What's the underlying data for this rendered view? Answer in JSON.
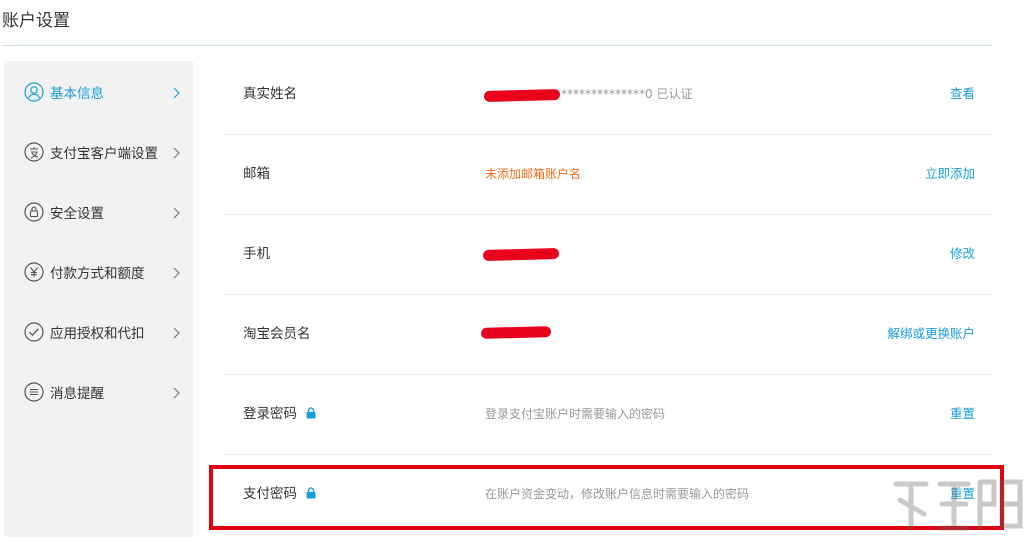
{
  "page": {
    "title": "账户设置"
  },
  "sidebar": {
    "items": [
      {
        "label": "基本信息",
        "icon": "user-icon",
        "active": true
      },
      {
        "label": "支付宝客户端设置",
        "icon": "alipay-client-icon",
        "active": false
      },
      {
        "label": "安全设置",
        "icon": "lock-icon",
        "active": false
      },
      {
        "label": "付款方式和额度",
        "icon": "yen-icon",
        "active": false
      },
      {
        "label": "应用授权和代扣",
        "icon": "check-circle-icon",
        "active": false
      },
      {
        "label": "消息提醒",
        "icon": "message-icon",
        "active": false
      }
    ]
  },
  "rows": [
    {
      "label": "真实姓名",
      "value": "**************0 已认证",
      "action": "查看",
      "redacted": true
    },
    {
      "label": "邮箱",
      "value": "未添加邮箱账户名",
      "action": "立即添加",
      "warn": true
    },
    {
      "label": "手机",
      "value": "",
      "action": "修改",
      "redacted": true
    },
    {
      "label": "淘宝会员名",
      "value": "",
      "action": "解绑或更换账户",
      "redacted": true
    },
    {
      "label": "登录密码",
      "value": "登录支付宝账户时需要输入的密码",
      "action": "重置",
      "lock": true
    },
    {
      "label": "支付密码",
      "value": "在账户资金变动，修改账户信息时需要输入的密码",
      "action": "重置",
      "lock": true
    }
  ],
  "colors": {
    "accent": "#1a9ddb",
    "warning": "#f06a1d",
    "highlight": "#e10010",
    "redaction": "#e8001c"
  }
}
